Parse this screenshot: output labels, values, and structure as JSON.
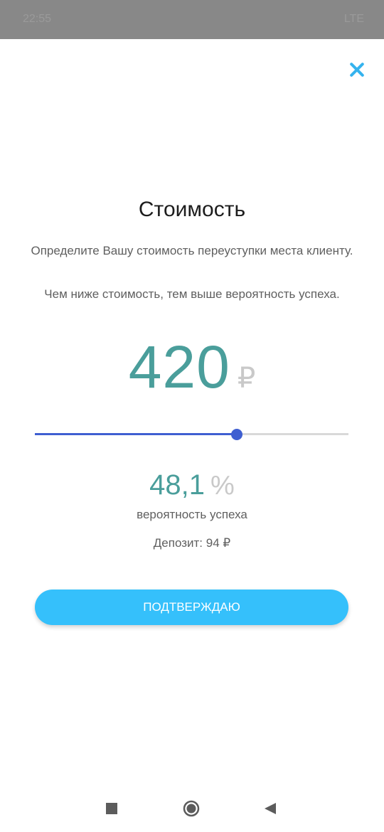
{
  "status_bar": {
    "time": "22:55",
    "right_text": "LTE"
  },
  "dialog": {
    "close_icon": "close-icon",
    "title": "Стоимость",
    "description": "Определите Вашу стоимость переуступки места клиенту.",
    "hint": "Чем ниже стоимость, тем выше вероятность успеха.",
    "price_value": "420",
    "price_currency": "₽",
    "slider_fraction": 0.645,
    "probability_value": "48,1",
    "probability_unit": "%",
    "probability_label": "вероятность успеха",
    "deposit": "Депозит: 94 ₽",
    "confirm_label": "ПОДТВЕРЖДАЮ"
  },
  "nav_bar": {
    "icons": [
      "recents-icon",
      "home-icon",
      "back-icon"
    ]
  },
  "colors": {
    "accent_teal": "#4a9e9b",
    "accent_blue": "#35c0fb",
    "slider_blue": "#3f5fd1",
    "close_blue": "#35b3ee"
  }
}
